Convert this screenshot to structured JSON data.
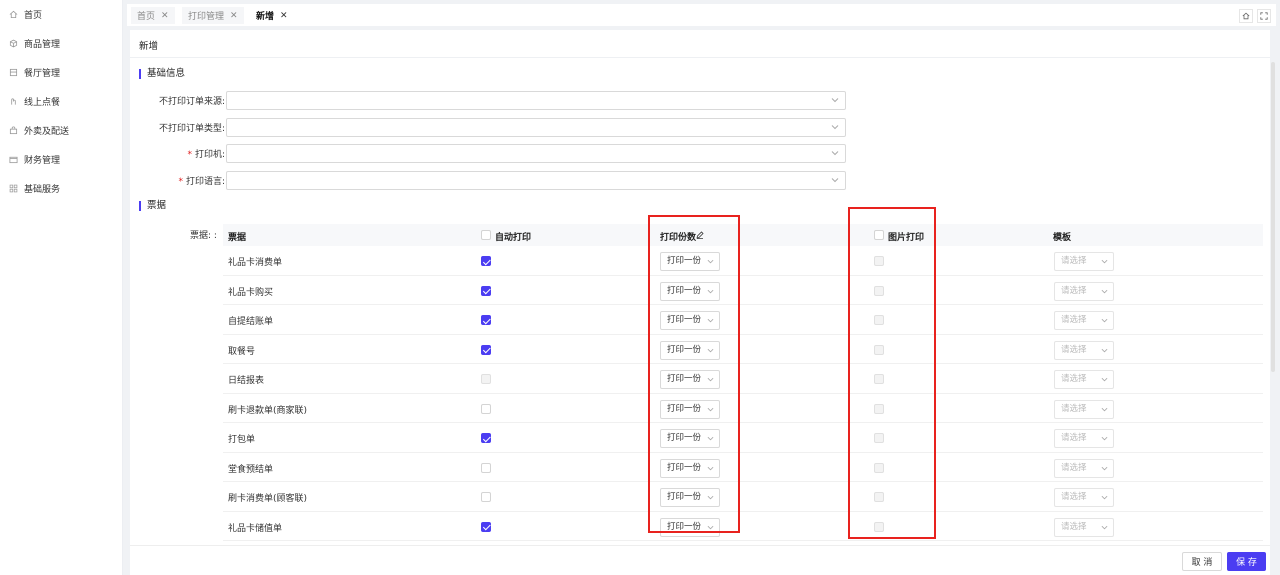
{
  "sidebar": {
    "items": [
      {
        "label": "首页",
        "icon": "home-icon"
      },
      {
        "label": "商品管理",
        "icon": "box-icon"
      },
      {
        "label": "餐厅管理",
        "icon": "store-icon"
      },
      {
        "label": "线上点餐",
        "icon": "hand-icon"
      },
      {
        "label": "外卖及配送",
        "icon": "bag-icon"
      },
      {
        "label": "财务管理",
        "icon": "wallet-icon"
      },
      {
        "label": "基础服务",
        "icon": "grid-icon"
      }
    ]
  },
  "tabs": [
    {
      "label": "首页",
      "close": "✕",
      "active": false
    },
    {
      "label": "打印管理",
      "close": "✕",
      "active": false
    },
    {
      "label": "新增",
      "close": "✕",
      "active": true
    }
  ],
  "page": {
    "title": "新增"
  },
  "basic": {
    "title": "基础信息",
    "fields": [
      {
        "label": "不打印订单来源:",
        "required": false,
        "value": ""
      },
      {
        "label": "不打印订单类型:",
        "required": false,
        "value": ""
      },
      {
        "label": "打印机:",
        "required": true,
        "value": ""
      },
      {
        "label": "打印语言:",
        "required": true,
        "value": ""
      }
    ]
  },
  "tickets": {
    "title": "票据",
    "label": "票据: :",
    "headers": {
      "name": "票据",
      "auto": "自动打印",
      "copies": "打印份数",
      "image": "图片打印",
      "template": "模板"
    },
    "rows": [
      {
        "name": "礼品卡消费单",
        "auto": "checked",
        "copies": "打印一份",
        "template": "请选择"
      },
      {
        "name": "礼品卡购买",
        "auto": "checked",
        "copies": "打印一份",
        "template": "请选择"
      },
      {
        "name": "自提结账单",
        "auto": "checked",
        "copies": "打印一份",
        "template": "请选择"
      },
      {
        "name": "取餐号",
        "auto": "checked",
        "copies": "打印一份",
        "template": "请选择"
      },
      {
        "name": "日结报表",
        "auto": "disabled",
        "copies": "打印一份",
        "template": "请选择"
      },
      {
        "name": "刷卡退款单(商家联)",
        "auto": "unchecked",
        "copies": "打印一份",
        "template": "请选择"
      },
      {
        "name": "打包单",
        "auto": "checked",
        "copies": "打印一份",
        "template": "请选择"
      },
      {
        "name": "堂食预结单",
        "auto": "unchecked",
        "copies": "打印一份",
        "template": "请选择"
      },
      {
        "name": "刷卡消费单(顾客联)",
        "auto": "unchecked",
        "copies": "打印一份",
        "template": "请选择"
      },
      {
        "name": "礼品卡储值单",
        "auto": "checked",
        "copies": "打印一份",
        "template": "请选择"
      }
    ]
  },
  "footer": {
    "cancel": "取 消",
    "save": "保 存"
  },
  "colors": {
    "accent": "#4b3df2",
    "highlight": "#e8221e"
  }
}
